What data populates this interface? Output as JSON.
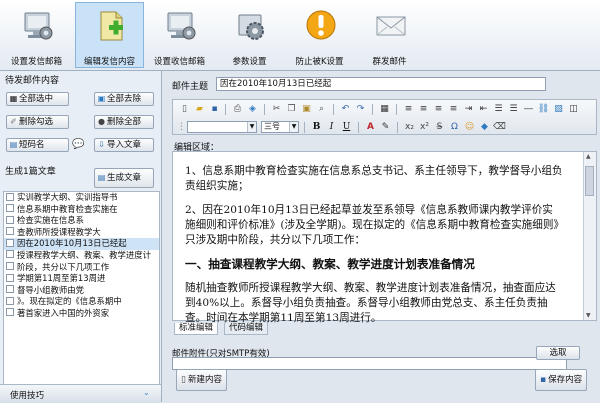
{
  "toolbar": {
    "buttons": [
      {
        "label": "设置发信邮箱",
        "icon": "computer-gear-icon",
        "active": false
      },
      {
        "label": "编辑发信内容",
        "icon": "document-add-icon",
        "active": true
      },
      {
        "label": "设置收信邮箱",
        "icon": "computer-gear-icon",
        "active": false
      },
      {
        "label": "参数设置",
        "icon": "gear-icon",
        "active": false
      },
      {
        "label": "防止被K设置",
        "icon": "warning-icon",
        "active": false
      },
      {
        "label": "群发邮件",
        "icon": "envelope-icon",
        "active": false
      }
    ]
  },
  "left": {
    "title": "待发邮件内容",
    "buttons": {
      "select_all": "全部选中",
      "clear_all": "全部去除",
      "delete_checked": "删除勾选",
      "delete_all": "删除全部",
      "short_name": "短码名",
      "import_article": "导入文章",
      "generate_article": "生成文章"
    },
    "generate_label": "生成1篇文章",
    "articles": [
      "实训教学大纲、实训指导书",
      "信息系期中教育检查实施在",
      "检查实施在信息系",
      "查教师所授课程教学大",
      "因在2010年10月13日已经起",
      "授课程教学大纲、教案、教学进度计",
      "阶段，共分以下几项工作",
      "学期第11周至第13周进",
      "督导小组教师由党",
      "》。现在拟定的《信息系期中",
      "著首家进入中国的外资家"
    ],
    "selected_index": 4,
    "tips": "使用技巧"
  },
  "right": {
    "subject_label": "邮件主题",
    "subject_value": "因在2010年10月13日已经起",
    "font_size_value": "三号",
    "edit_region_label": "编辑区域：",
    "body": {
      "p1": "1、信息系期中教育检查实施在信息系总支书记、系主任领导下，教学督导小组负责组织实施；",
      "p2": "2、因在2010年10月13日已经起草並发至系领导《信息系教师课内教学评价实施细则和评价标准》(涉及全学期)。现在拟定的《信息系期中教育检查实施细则》只涉及期中阶段，共分以下几项工作：",
      "heading": "一、抽查课程教学大纲、教案、教学进度计划表准备情况",
      "p3": "随机抽查教师所授课程教学大纲、教案、教学进度计划表准备情况，抽查面应达到40%以上。系督导小组负责抽查。系督导小组教师由党总支、系主任负责抽查。时间在本学期第11周至第13周进行。"
    },
    "tabs": [
      "标准编辑",
      "代码编辑"
    ],
    "active_tab": 0,
    "attach_label": "邮件附件(只对SMTP有效)",
    "browse_button": "选取",
    "new_button": "新建内容",
    "save_button": "保存内容"
  }
}
